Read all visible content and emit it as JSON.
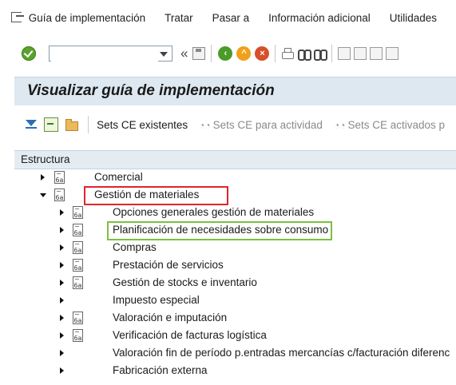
{
  "menubar": {
    "items": [
      "Guía de implementación",
      "Tratar",
      "Pasar a",
      "Información adicional",
      "Utilidades"
    ]
  },
  "toolbar": {
    "command_value": "",
    "nav_glyph": "«"
  },
  "title": "Visualizar guía de implementación",
  "app_toolbar": {
    "existing_label": "Sets CE existentes",
    "activity_label": "Sets CE para actividad",
    "activated_label": "Sets CE activados p"
  },
  "tree": {
    "header": "Estructura",
    "nodes": [
      {
        "label": "Comercial",
        "level": 1,
        "expanded": false,
        "icon": "document-icon"
      },
      {
        "label": "Gestión de materiales",
        "level": 1,
        "expanded": true,
        "icon": "document-icon"
      },
      {
        "label": "Opciones generales gestión de materiales",
        "level": 2,
        "icon": "document-icon"
      },
      {
        "label": "Planificación de necesidades sobre consumo",
        "level": 2,
        "icon": "document-icon"
      },
      {
        "label": "Compras",
        "level": 2,
        "icon": "document-icon"
      },
      {
        "label": "Prestación de servicios",
        "level": 2,
        "icon": "document-icon"
      },
      {
        "label": "Gestión de stocks e inventario",
        "level": 2,
        "icon": "document-icon"
      },
      {
        "label": "Impuesto especial",
        "level": 2,
        "icon": null
      },
      {
        "label": "Valoración e imputación",
        "level": 2,
        "icon": "document-icon"
      },
      {
        "label": "Verificación de facturas logística",
        "level": 2,
        "icon": "document-icon"
      },
      {
        "label": "Valoración fin de período p.entradas mercancías c/facturación diferenc",
        "level": 2,
        "icon": null
      },
      {
        "label": "Fabricación externa",
        "level": 2,
        "icon": null
      }
    ]
  },
  "colors": {
    "highlight_red": "#e0242c",
    "highlight_green": "#7cc043",
    "title_bg": "#dde8f0"
  }
}
